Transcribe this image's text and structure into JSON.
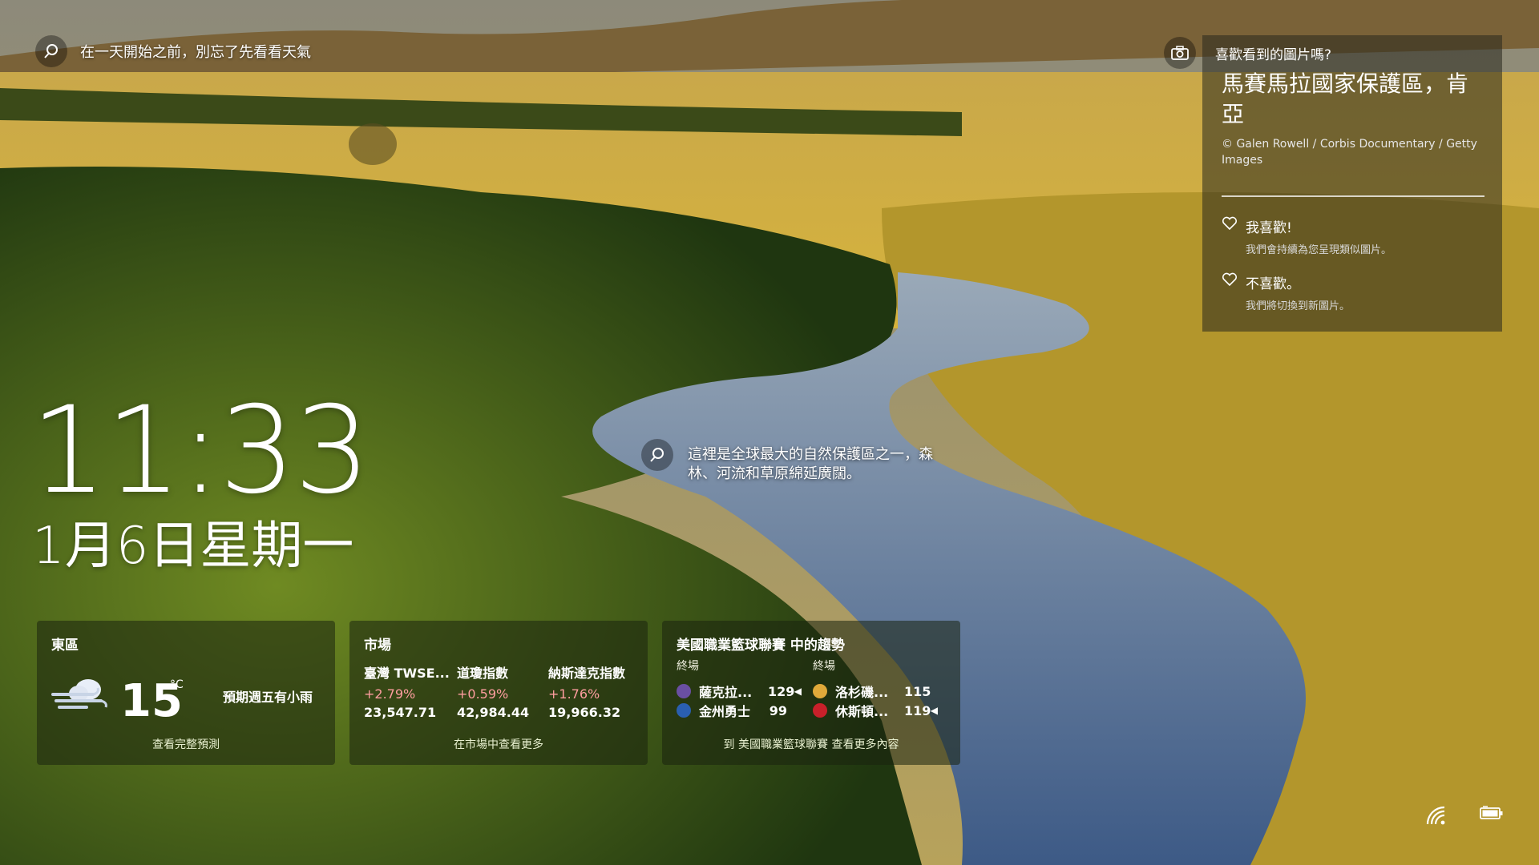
{
  "top_search": {
    "text": "在一天開始之前，別忘了先看看天氣"
  },
  "clock": {
    "time": "11:33",
    "date": "1月6日星期一"
  },
  "fact": {
    "text": "這裡是全球最大的自然保護區之一，森林、河流和草原綿延廣闊。"
  },
  "photo_panel": {
    "question": "喜歡看到的圖片嗎?",
    "title": "馬賽馬拉國家保護區，肯亞",
    "credit": "© Galen Rowell / Corbis Documentary / Getty Images",
    "like_label": "我喜歡!",
    "like_sub": "我們會持續為您呈現類似圖片。",
    "dislike_label": "不喜歡。",
    "dislike_sub": "我們將切換到新圖片。"
  },
  "weather": {
    "location": "東區",
    "temp": "15",
    "unit": "°C",
    "forecast": "預期週五有小雨",
    "more": "查看完整預測"
  },
  "market": {
    "title": "市場",
    "items": [
      {
        "name": "臺灣 TWSE...",
        "change": "+2.79%",
        "value": "23,547.71"
      },
      {
        "name": "道瓊指數",
        "change": "+0.59%",
        "value": "42,984.44"
      },
      {
        "name": "納斯達克指數",
        "change": "+1.76%",
        "value": "19,966.32"
      }
    ],
    "more": "在市場中查看更多"
  },
  "nba": {
    "title": "美國職業籃球聯賽 中的趨勢",
    "games": [
      {
        "status": "終場",
        "teams": [
          {
            "name": "薩克拉...",
            "score": "129",
            "winner": true
          },
          {
            "name": "金州勇士",
            "score": "99",
            "winner": false
          }
        ]
      },
      {
        "status": "終場",
        "teams": [
          {
            "name": "洛杉磯...",
            "score": "115",
            "winner": false
          },
          {
            "name": "休斯頓...",
            "score": "119",
            "winner": true
          }
        ]
      }
    ],
    "more": "到 美國職業籃球聯賽 查看更多內容"
  },
  "colors": {
    "market_up": "#ff9ea0",
    "card_bg": "rgba(25,35,15,0.55)"
  },
  "icons": [
    "search-icon",
    "camera-icon",
    "heart-icon",
    "wifi-icon",
    "battery-icon",
    "wind-cloud-icon"
  ]
}
